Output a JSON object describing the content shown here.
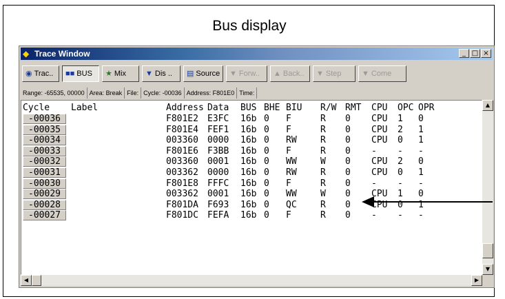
{
  "caption": "Bus display",
  "window": {
    "title": "Trace Window"
  },
  "toolbar": [
    {
      "label": "Trac..",
      "icon": "trace-icon",
      "name": "trace-button",
      "active": false,
      "disabled": false
    },
    {
      "label": "BUS",
      "icon": "bus-icon",
      "name": "bus-button",
      "active": true,
      "disabled": false
    },
    {
      "label": "Mix",
      "icon": "mix-icon",
      "name": "mix-button",
      "active": false,
      "disabled": false
    },
    {
      "label": "Dis ..",
      "icon": "disassemble-icon",
      "name": "disassemble-button",
      "active": false,
      "disabled": false
    },
    {
      "label": "Source",
      "icon": "source-icon",
      "name": "source-button",
      "active": false,
      "disabled": false
    },
    {
      "label": "Forw..",
      "icon": "forward-icon",
      "name": "forward-button",
      "active": false,
      "disabled": true
    },
    {
      "label": "Back..",
      "icon": "back-icon",
      "name": "back-button",
      "active": false,
      "disabled": true
    },
    {
      "label": "Step",
      "icon": "step-icon",
      "name": "step-button",
      "active": false,
      "disabled": true
    },
    {
      "label": "Come",
      "icon": "come-icon",
      "name": "come-button",
      "active": false,
      "disabled": true
    }
  ],
  "status": [
    "Range: -65535, 00000",
    "Area: Break",
    "File:",
    "Cycle: -00036",
    "Address: F801E0",
    "Time:"
  ],
  "columns": [
    "Cycle",
    "Label",
    "Address",
    "Data",
    "BUS",
    "BHE",
    "BIU",
    "R/W",
    "RMT",
    "CPU",
    "OPC",
    "OPR"
  ],
  "rows": [
    [
      "-00036",
      "",
      "F801E2",
      "E3FC",
      "16b",
      "0",
      "F",
      "R",
      "0",
      "CPU",
      "1",
      "0"
    ],
    [
      "-00035",
      "",
      "F801E4",
      "FEF1",
      "16b",
      "0",
      "F",
      "R",
      "0",
      "CPU",
      "2",
      "1"
    ],
    [
      "-00034",
      "",
      "003360",
      "0000",
      "16b",
      "0",
      "RW",
      "R",
      "0",
      "CPU",
      "0",
      "1"
    ],
    [
      "-00033",
      "",
      "F801E6",
      "F3BB",
      "16b",
      "0",
      "F",
      "R",
      "0",
      "-",
      "-",
      "-"
    ],
    [
      "-00032",
      "",
      "003360",
      "0001",
      "16b",
      "0",
      "WW",
      "W",
      "0",
      "CPU",
      "2",
      "0"
    ],
    [
      "-00031",
      "",
      "003362",
      "0000",
      "16b",
      "0",
      "RW",
      "R",
      "0",
      "CPU",
      "0",
      "1"
    ],
    [
      "-00030",
      "",
      "F801E8",
      "FFFC",
      "16b",
      "0",
      "F",
      "R",
      "0",
      "-",
      "-",
      "-"
    ],
    [
      "-00029",
      "",
      "003362",
      "0001",
      "16b",
      "0",
      "WW",
      "W",
      "0",
      "CPU",
      "1",
      "0"
    ],
    [
      "-00028",
      "",
      "F801DA",
      "F693",
      "16b",
      "0",
      "QC",
      "R",
      "0",
      "CPU",
      "0",
      "1"
    ],
    [
      "-00027",
      "",
      "F801DC",
      "FEFA",
      "16b",
      "0",
      "F",
      "R",
      "0",
      "-",
      "-",
      "-"
    ]
  ],
  "colors": {
    "accent": "#0a246a",
    "face": "#d4d0c8",
    "disabled": "#9c9a94"
  }
}
